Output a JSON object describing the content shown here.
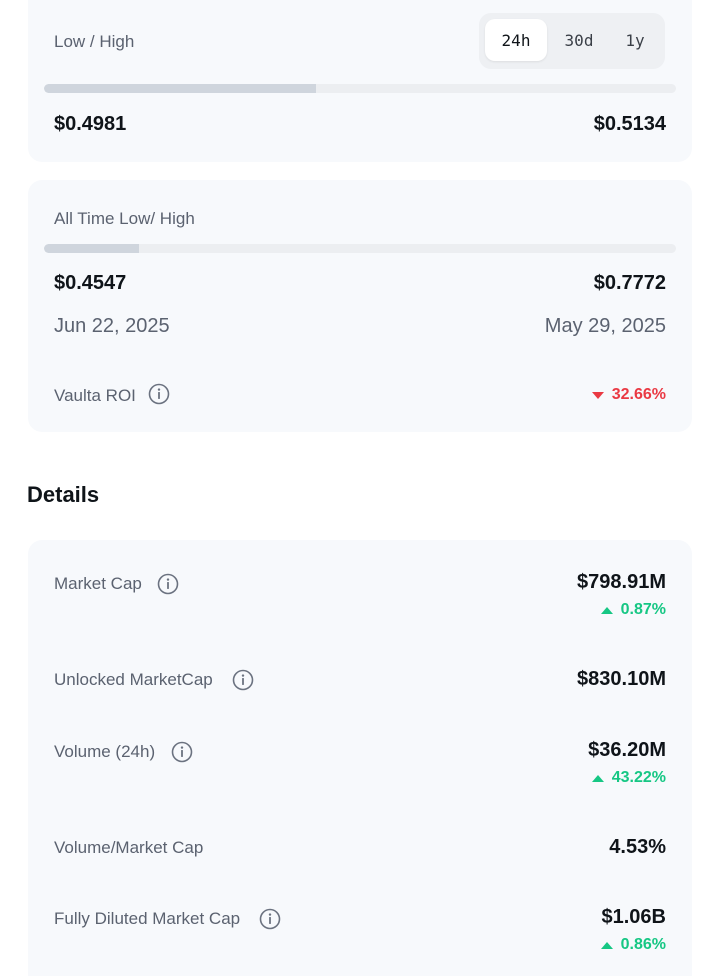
{
  "low_high": {
    "label": "Low / High",
    "periods": [
      "24h",
      "30d",
      "1y"
    ],
    "active_period": "24h",
    "progress_fraction": 0.43,
    "low": "$0.4981",
    "high": "$0.5134"
  },
  "all_time": {
    "label": "All Time Low/ High",
    "progress_fraction": 0.15,
    "low": "$0.4547",
    "high": "$0.7772",
    "low_date": "Jun 22, 2025",
    "high_date": "May 29, 2025",
    "roi_label": "Vaulta ROI",
    "roi_value": "32.66%",
    "roi_direction": "down"
  },
  "details": {
    "heading": "Details",
    "rows": [
      {
        "label": "Market Cap",
        "value": "$798.91M",
        "change": "0.87%",
        "direction": "up",
        "info": true
      },
      {
        "label": "Unlocked MarketCap",
        "value": "$830.10M",
        "change": "",
        "direction": "",
        "info": true
      },
      {
        "label": "Volume (24h)",
        "value": "$36.20M",
        "change": "43.22%",
        "direction": "up",
        "info": true
      },
      {
        "label": "Volume/Market Cap",
        "value": "4.53%",
        "change": "",
        "direction": "",
        "info": false
      },
      {
        "label": "Fully Diluted Market Cap",
        "value": "$1.06B",
        "change": "0.86%",
        "direction": "up",
        "info": true
      }
    ]
  },
  "colors": {
    "up": "#16c784",
    "down": "#ea3943",
    "card_bg": "#f7f9fc",
    "bar_fill": "#cfd5dd"
  },
  "icons": {
    "info": "info-circle-icon",
    "up": "triangle-up-icon",
    "down": "triangle-down-icon"
  }
}
